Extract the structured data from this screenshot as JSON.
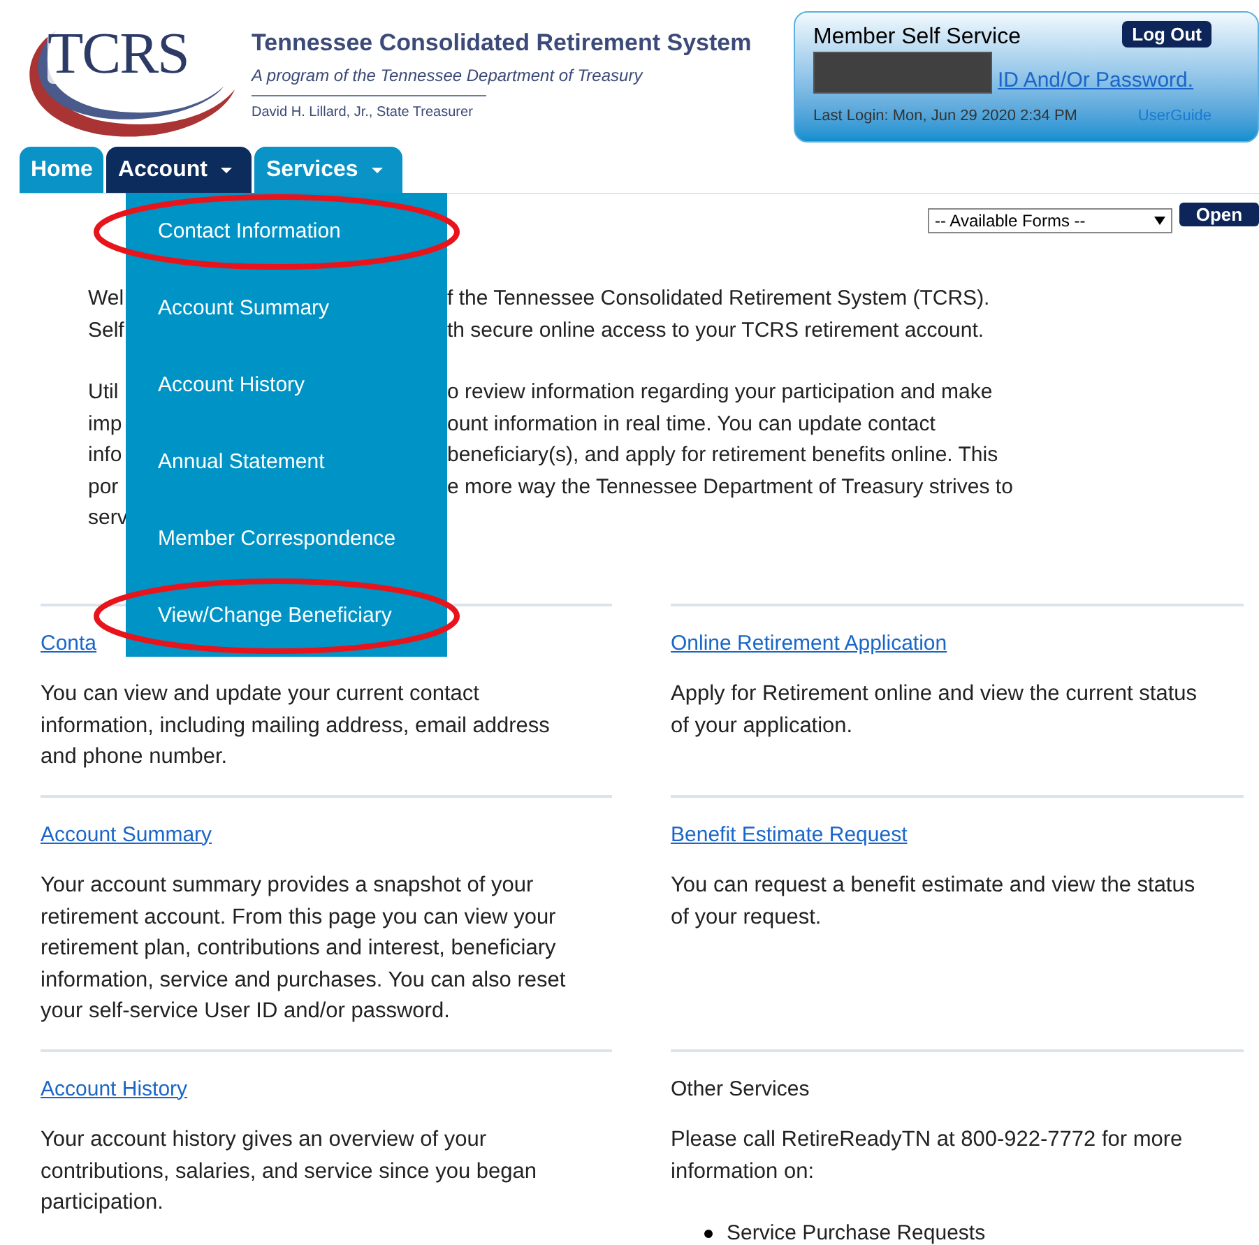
{
  "logo": {
    "text": "TCRS"
  },
  "header": {
    "title": "Tennessee Consolidated Retirement System",
    "subtitle": "A program of the Tennessee Department of Treasury",
    "treasurer": "David H. Lillard, Jr., State Treasurer"
  },
  "member_box": {
    "title": "Member Self Service",
    "logout": "Log Out",
    "link": "ID And/Or Password.",
    "last_login": "Last Login: Mon, Jun 29 2020 2:34 PM",
    "user_guide": "UserGuide"
  },
  "tabs": [
    {
      "label": "Home",
      "selected": false,
      "dropdown": false
    },
    {
      "label": "Account",
      "selected": true,
      "dropdown": true
    },
    {
      "label": "Services",
      "selected": false,
      "dropdown": true
    }
  ],
  "menu": [
    {
      "label": "Contact Information",
      "circled": true
    },
    {
      "label": "Account Summary",
      "circled": false
    },
    {
      "label": "Account History",
      "circled": false
    },
    {
      "label": "Annual Statement",
      "circled": false
    },
    {
      "label": "Member Correspondence",
      "circled": false
    },
    {
      "label": "View/Change Beneficiary",
      "circled": true
    }
  ],
  "forms": {
    "select": "-- Available Forms --",
    "button": "Open"
  },
  "intro": [
    [
      {
        "left": "Wel",
        "right": "f the Tennessee Consolidated Retirement System (TCRS)."
      },
      {
        "left": "Self",
        "right": "th secure online access to your TCRS retirement account."
      }
    ],
    [
      {
        "left": "Util",
        "right": "o review information regarding your participation and make"
      },
      {
        "left": "imp",
        "right": "ount information in real time. You can update contact"
      },
      {
        "left": "info",
        "right": "beneficiary(s), and apply for retirement benefits online. This"
      },
      {
        "left": "por",
        "right": "e more way the Tennessee Department of Treasury strives to"
      },
      {
        "left": "serv"
      }
    ]
  ],
  "sections": [
    {
      "kind": "link",
      "title": "Conta",
      "text": "You can view and update your current contact information, including mailing address, email address and phone number."
    },
    {
      "kind": "link",
      "title": "Online Retirement Application",
      "text": "Apply for Retirement online and view the current status of your application."
    },
    {
      "kind": "link",
      "title": "Account Summary",
      "text": "Your account summary provides a snapshot of your retirement account. From this page you can view your retirement plan, contributions and interest, beneficiary information, service and purchases. You can also reset your self-service User ID and/or password."
    },
    {
      "kind": "link",
      "title": "Benefit Estimate Request",
      "text": "You can request a benefit estimate and view the status of your request."
    },
    {
      "kind": "link",
      "title": "Account History",
      "text": "Your account history gives an overview of your contributions, salaries, and service since you began participation."
    },
    {
      "kind": "heading",
      "title": "Other Services",
      "text": "Please call RetireReadyTN at 800-922-7772 for more information on:",
      "bullets": [
        "Service Purchase Requests"
      ]
    }
  ]
}
